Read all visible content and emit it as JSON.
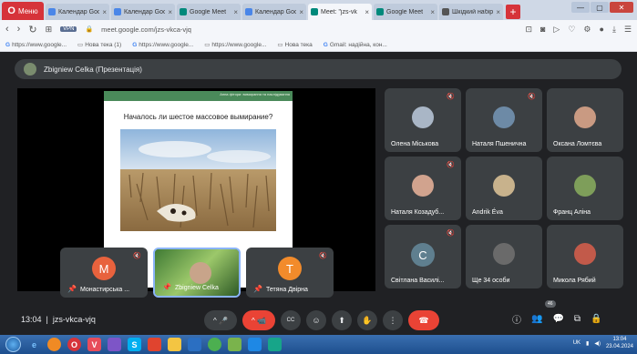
{
  "browser": {
    "menu_label": "Меню",
    "tabs": [
      {
        "title": "Календар Goog",
        "color": "#4a86e8",
        "active": false
      },
      {
        "title": "Календар Goog",
        "color": "#4a86e8",
        "active": false
      },
      {
        "title": "Google Meet",
        "color": "#00897b",
        "active": false
      },
      {
        "title": "Календар Goog",
        "color": "#4a86e8",
        "active": false
      },
      {
        "title": "Meet: \"jzs-vk",
        "color": "#00897b",
        "active": true
      },
      {
        "title": "Google Meet",
        "color": "#00897b",
        "active": false
      },
      {
        "title": "Шкідкий набір",
        "color": "#555555",
        "active": false
      }
    ],
    "tab_close": "×",
    "new_tab": "+",
    "win_min": "—",
    "win_max": "▢",
    "win_close": "✕",
    "vpn": "VPN",
    "url": "meet.google.com/jzs-vkca-vjq",
    "bookmarks": [
      {
        "icon": "G",
        "label": "https://www.google..."
      },
      {
        "icon": "▭",
        "label": "Нова тека (1)"
      },
      {
        "icon": "G",
        "label": "https://www.google..."
      },
      {
        "icon": "▭",
        "label": "https://www.google..."
      },
      {
        "icon": "▭",
        "label": "Нова тека"
      },
      {
        "icon": "G",
        "label": "Gmail: надійна, кон..."
      }
    ]
  },
  "meet": {
    "presenter": "Zbigniew Celka (Презентація)",
    "slide": {
      "caption": "Анна фітори: вимирання та наслідування",
      "title": "Началось ли шестое массовое вымирание?"
    },
    "participants": [
      {
        "name": "Олена Міськова",
        "muted": true
      },
      {
        "name": "Наталя Пшенична",
        "muted": true
      },
      {
        "name": "Оксана Ломтєва",
        "muted": false
      },
      {
        "name": "Наталя Козадуб...",
        "muted": true
      },
      {
        "name": "Andrik Éva",
        "muted": false
      },
      {
        "name": "Франц Аліна",
        "muted": false
      },
      {
        "name": "Світлана Василі...",
        "muted": true,
        "letter": "C"
      },
      {
        "name": "Ще 34 особи",
        "muted": false
      },
      {
        "name": "Микола Рябий",
        "muted": false
      }
    ],
    "bottom_participants": [
      {
        "name": "Монастирська ...",
        "letter": "M",
        "color": "#e8623d"
      },
      {
        "name": "Zbigniew Celka",
        "speaking": true
      },
      {
        "name": "Тетяна Двірна",
        "letter": "T",
        "color": "#f28b2b"
      }
    ],
    "time": "13:04",
    "separator": "|",
    "meeting_code": "jzs-vkca-vjq",
    "people_count": "46",
    "icons": {
      "mute": "🔇",
      "pin": "📌",
      "mic": "🎤",
      "cam": "📹",
      "cc": "CC",
      "emoji": "☺",
      "present": "⬆",
      "hand": "✋",
      "more": "⋮",
      "end": "☎",
      "info": "ⓘ",
      "people": "👥",
      "chat": "💬",
      "activities": "⧉",
      "lock": "🔒",
      "caret": "^"
    }
  },
  "taskbar": {
    "lang": "UK",
    "time": "13:04",
    "date": "23.04.2024"
  }
}
